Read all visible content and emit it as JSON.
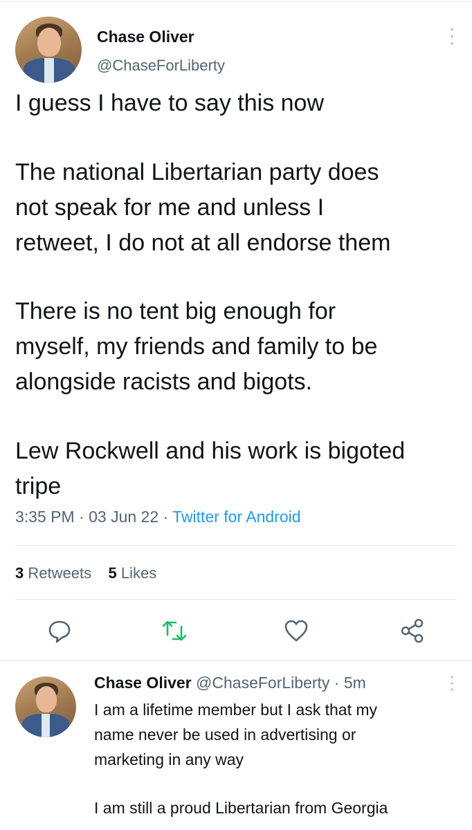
{
  "tweet": {
    "author_name": "Chase Oliver",
    "author_handle": "@ChaseForLiberty",
    "lines": [
      "I guess I have to say this now",
      "The national Libertarian party does",
      "not speak for me and unless I",
      "retweet, I do not at all endorse them",
      "There is no tent big enough for",
      "myself, my friends and family to be",
      "alongside racists and bigots.",
      "Lew Rockwell and his work is bigoted",
      "tripe"
    ],
    "time": "3:35 PM",
    "date": "03 Jun 22",
    "source": "Twitter for Android",
    "retweets_count": "3",
    "retweets_label": "Retweets",
    "likes_count": "5",
    "likes_label": "Likes"
  },
  "actions": {
    "icons": [
      "reply-icon",
      "retweet-icon",
      "like-icon",
      "share-icon"
    ],
    "retweet_color": "#17bf63",
    "icon_color": "#536471"
  },
  "reply": {
    "author_name": "Chase Oliver",
    "author_handle": "@ChaseForLiberty",
    "age": "5m",
    "lines": [
      "I am a lifetime member but I ask that my",
      "name never be used in advertising or",
      "marketing in any way",
      "I am still a proud Libertarian from Georgia"
    ]
  }
}
